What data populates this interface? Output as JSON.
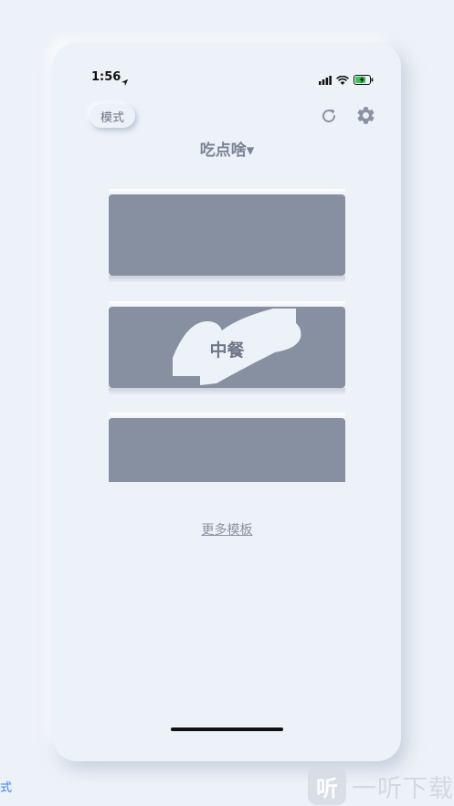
{
  "status_bar": {
    "time": "1:56"
  },
  "header": {
    "mode_label": "模式",
    "title": "吃点啥▾"
  },
  "cards": [
    {
      "label": ""
    },
    {
      "label": "中餐"
    },
    {
      "label": ""
    }
  ],
  "more_templates_label": "更多模板",
  "edge_text": "式",
  "watermark": {
    "logo_char": "听",
    "text": "一听下载"
  },
  "colors": {
    "background": "#edf1f8",
    "card": "#8790a0",
    "text_muted": "#7b8496",
    "link_blue": "#3b82f6"
  },
  "icons": [
    "location-arrow-icon",
    "signal-icon",
    "wifi-icon",
    "battery-charging-icon",
    "refresh-icon",
    "gear-icon"
  ]
}
